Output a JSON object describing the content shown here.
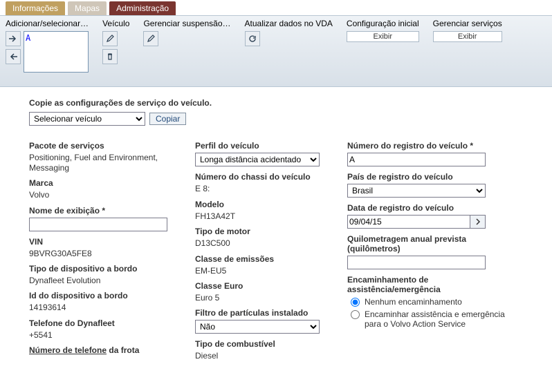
{
  "tabs": {
    "informacoes": "Informações",
    "mapas": "Mapas",
    "administracao": "Administração"
  },
  "toolbar": {
    "add_select_title": "Adicionar/selecionar…",
    "add_select_value": "A",
    "veiculo_title": "Veículo",
    "gerenciar_susp_title": "Gerenciar suspensão…",
    "atualizar_vda_title": "Atualizar dados no VDA",
    "config_inicial_title": "Configuração inicial",
    "gerenciar_servicos_title": "Gerenciar serviços",
    "exibir_label": "Exibir"
  },
  "copy": {
    "label": "Copie as configurações de serviço do veículo.",
    "select_placeholder": "Selecionar veículo",
    "copiar_label": "Copiar"
  },
  "col1": {
    "pacote_label": "Pacote de serviços",
    "pacote_value": "Positioning, Fuel and Environment, Messaging",
    "marca_label": "Marca",
    "marca_value": "Volvo",
    "nome_exib_label": "Nome de exibição *",
    "nome_exib_value": "",
    "vin_label": "VIN",
    "vin_value": "9BVRG30A5FE8",
    "tipo_disp_label": "Tipo de dispositivo a bordo",
    "tipo_disp_value": "Dynafleet Evolution",
    "id_disp_label": "Id do dispositivo a bordo",
    "id_disp_value": "14193614",
    "tel_dyna_label": "Telefone do Dynafleet",
    "tel_dyna_value": "+5541",
    "tel_frota_label_pref": "Número de telefone",
    "tel_frota_label_suf": " da frota"
  },
  "col2": {
    "perfil_label": "Perfil do veículo",
    "perfil_value": "Longa distância acidentado",
    "chassi_label": "Número do chassi do veículo",
    "chassi_value": "E 8:",
    "modelo_label": "Modelo",
    "modelo_value": "FH13A42T",
    "motor_label": "Tipo de motor",
    "motor_value": "D13C500",
    "emissoes_label": "Classe de emissões",
    "emissoes_value": "EM-EU5",
    "euro_label": "Classe Euro",
    "euro_value": "Euro 5",
    "filtro_label": "Filtro de partículas instalado",
    "filtro_value": "Não",
    "combustivel_label": "Tipo de combustível",
    "combustivel_value": "Diesel"
  },
  "col3": {
    "reg_num_label": "Número do registro do veículo *",
    "reg_num_value": "A",
    "pais_label": "País de registro do veículo",
    "pais_value": "Brasil",
    "data_label": "Data de registro do veículo",
    "data_value": "09/04/15",
    "km_label": "Quilometragem anual prevista (quilômetros)",
    "km_value": "",
    "encam_label": "Encaminhamento de assistência/emergência",
    "radio1_label": "Nenhum encaminhamento",
    "radio2_label": "Encaminhar assistência e emergência para o Volvo Action Service"
  }
}
